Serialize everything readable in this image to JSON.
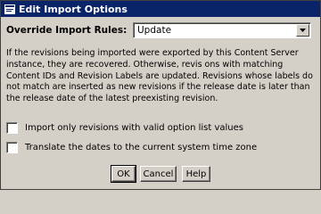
{
  "window": {
    "title": "Edit Import Options"
  },
  "override": {
    "label": "Override Import Rules:",
    "selected": "Update"
  },
  "description": "If the revisions being imported were exported by this Content Server instance, they are recovered. Otherwise, revis ons with matching Content IDs and Revision Labels are updated. Revisions whose labels do not match are inserted as new revisions if the release date is later than the release date of the latest preexisting revision.",
  "options": [
    {
      "label": "Import only revisions with valid option list values",
      "checked": false
    },
    {
      "label": "Translate the dates to the current system time zone",
      "checked": false
    }
  ],
  "buttons": {
    "ok": "OK",
    "cancel": "Cancel",
    "help": "Help"
  },
  "colors": {
    "titlebar": "#0a246a",
    "face": "#d4d0c8"
  },
  "icons": {
    "app": "app-window-icon",
    "dropdown": "chevron-down-icon"
  }
}
